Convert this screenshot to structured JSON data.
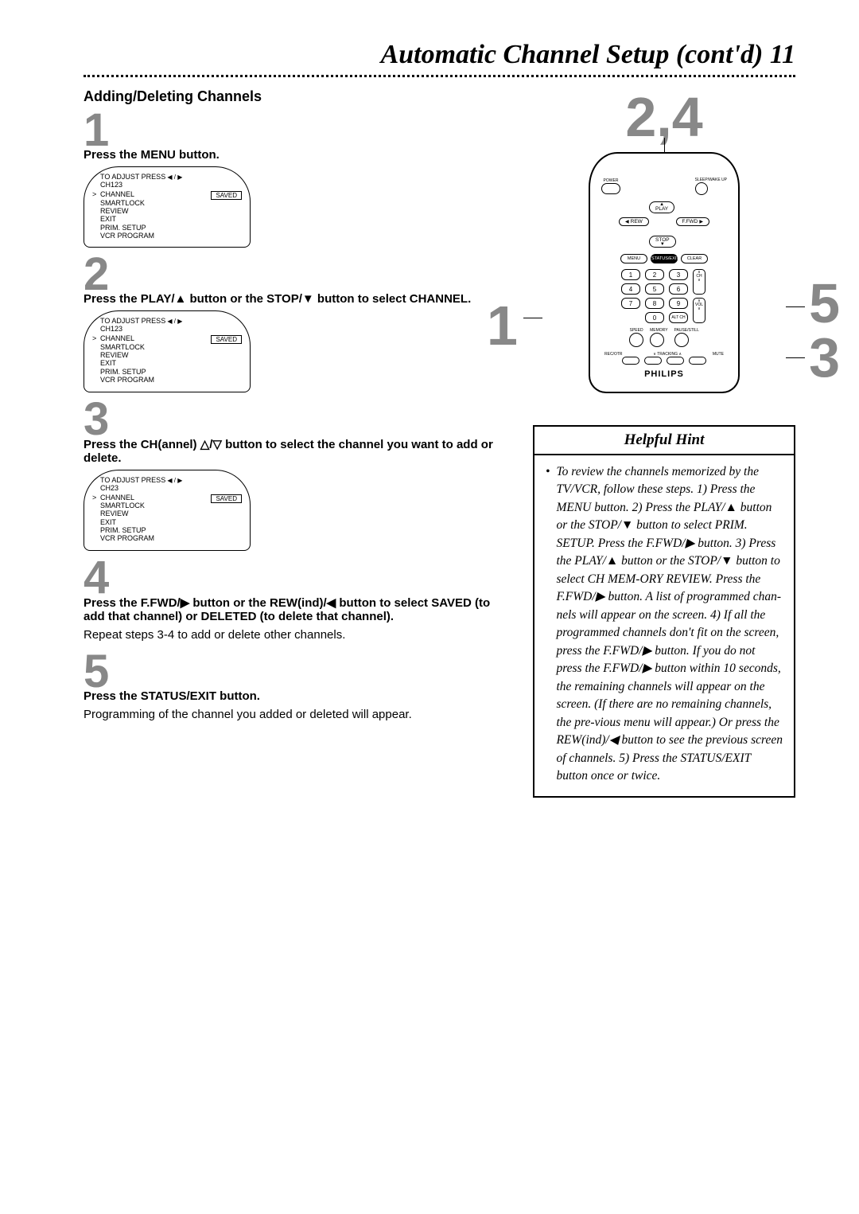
{
  "title": "Automatic Channel Setup (cont'd)  11",
  "section_head": "Adding/Deleting Channels",
  "steps": {
    "s1": {
      "num": "1",
      "text": "Press the MENU button."
    },
    "s2": {
      "num": "2",
      "text": "Press the PLAY/▲ button or the STOP/▼ button to select CHANNEL."
    },
    "s3": {
      "num": "3",
      "text": "Press the CH(annel) △/▽ button to select the channel you want to add or delete."
    },
    "s4": {
      "num": "4",
      "text": "Press the F.FWD/▶ button or the REW(ind)/◀ button to select SAVED (to add that channel) or DELETED (to delete that channel).",
      "note": "Repeat steps 3-4 to add or delete other channels."
    },
    "s5": {
      "num": "5",
      "text": "Press the STATUS/EXIT button.",
      "note": "Programming of the channel you added or deleted will appear."
    }
  },
  "tv": {
    "top1": "TO ADJUST PRESS",
    "ch_a": "CH123",
    "ch_b": "CH23",
    "items": [
      "CHANNEL",
      "SMARTLOCK",
      "REVIEW",
      "EXIT",
      "PRIM. SETUP",
      "VCR PROGRAM"
    ],
    "saved": "SAVED"
  },
  "remote": {
    "power": "POWER",
    "sleep": "SLEEP/WAKE UP",
    "play": "PLAY",
    "stop": "STOP",
    "rew": "REW",
    "ffwd": "F.FWD",
    "menu": "MENU",
    "status": "STATUS/EXIT",
    "clear": "CLEAR",
    "nums": [
      "1",
      "2",
      "3",
      "4",
      "5",
      "6",
      "7",
      "8",
      "9",
      "0"
    ],
    "ch": "CH",
    "vol": "VOL",
    "altch": "ALT CH",
    "speed": "SPEED",
    "memory": "MEMORY",
    "pause": "PAUSE/STILL",
    "recotr": "REC/OTR",
    "tracking": "TRACKING",
    "mute": "MUTE",
    "brand": "PHILIPS"
  },
  "callouts": {
    "top": "2,4",
    "left": "1",
    "r1": "5",
    "r2": "3"
  },
  "hint": {
    "head": "Helpful Hint",
    "body": "To review the channels memorized by the TV/VCR, follow these steps. 1) Press the MENU button. 2) Press the PLAY/▲ button or the STOP/▼ button to select PRIM. SETUP. Press the F.FWD/▶ button. 3) Press the PLAY/▲ button or the STOP/▼ button to select CH MEM-ORY REVIEW. Press the F.FWD/▶ button. A list of programmed chan-nels will appear on the screen. 4) If all the programmed channels don't fit on the screen, press the F.FWD/▶ button. If you do not press the F.FWD/▶ button within 10 seconds, the remaining channels will appear on the screen. (If there are no remaining channels, the pre-vious menu will appear.) Or press the REW(ind)/◀ button to see the previous screen of channels. 5) Press the STATUS/EXIT button once or twice."
  }
}
